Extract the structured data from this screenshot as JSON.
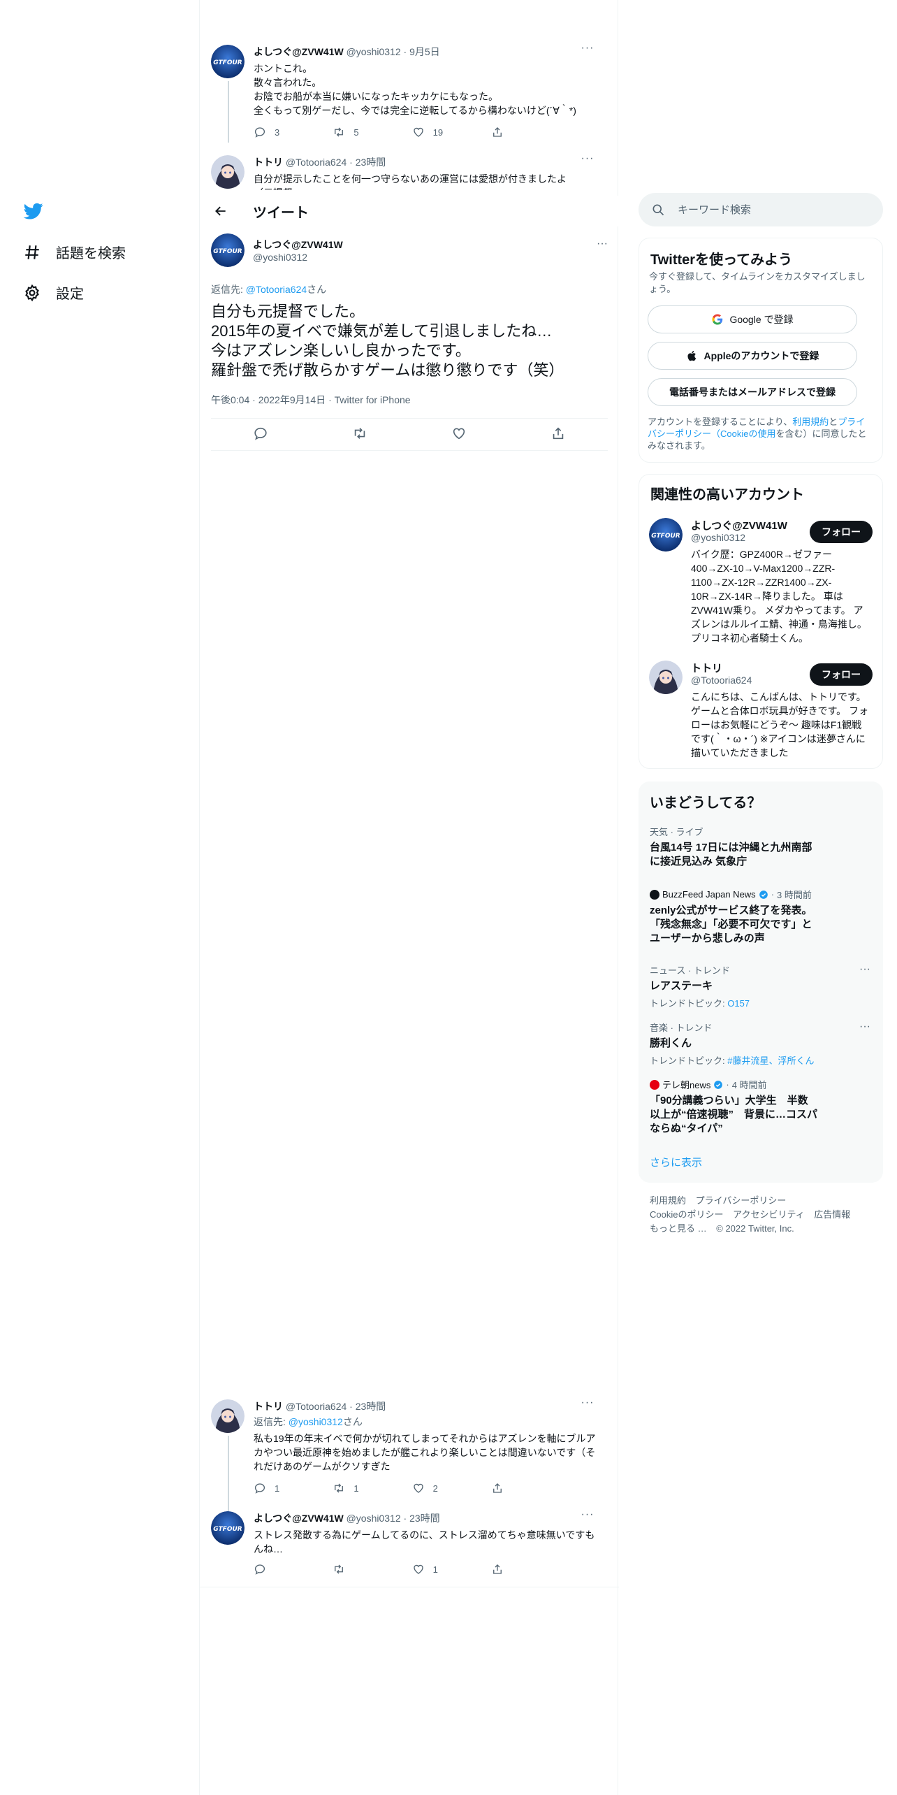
{
  "nav": {
    "explore_label": "話題を検索",
    "settings_label": "設定"
  },
  "header": {
    "title": "ツイート"
  },
  "tweets_above": [
    {
      "name": "よしつぐ@ZVW41W",
      "handle": "@yoshi0312",
      "time": "9月5日",
      "text": "ホントこれ。\n散々言われた。\nお陰でお船が本当に嫌いになったキッカケにもなった。\n全くもって別ゲーだし、今では完全に逆転してるから構わないけど(´∀｀*)",
      "replies": "3",
      "retweets": "5",
      "likes": "19"
    },
    {
      "name": "トトリ",
      "handle": "@Totooria624",
      "time": "23時間",
      "text": "自分が提示したことを何一つ守らないあの運営には愛想が付きましたよ\n（元提督"
    }
  ],
  "focused": {
    "name": "よしつぐ@ZVW41W",
    "handle": "@yoshi0312",
    "replying_prefix": "返信先: ",
    "replying_to": "@Totooria624",
    "replying_suffix": "さん",
    "text": "自分も元提督でした。\n2015年の夏イベで嫌気が差して引退しましたね…\n今はアズレン楽しいし良かったです。\n羅針盤で禿げ散らかすゲームは懲り懲りです（笑）",
    "meta": "午後0:04 · 2022年9月14日 · Twitter for iPhone"
  },
  "replies_below": [
    {
      "name": "トトリ",
      "handle": "@Totooria624",
      "time": "23時間",
      "replying_prefix": "返信先: ",
      "replying_to": "@yoshi0312",
      "replying_suffix": "さん",
      "text": "私も19年の年末イベで何かが切れてしまってそれからはアズレンを軸にブルアカやつい最近原神を始めましたが艦これより楽しいことは間違いないです（それだけあのゲームがクソすぎた",
      "replies": "1",
      "retweets": "1",
      "likes": "2"
    },
    {
      "name": "よしつぐ@ZVW41W",
      "handle": "@yoshi0312",
      "time": "23時間",
      "text": "ストレス発散する為にゲームしてるのに、ストレス溜めてちゃ意味無いですもんね…",
      "likes": "1"
    }
  ],
  "search": {
    "placeholder": "キーワード検索"
  },
  "signup": {
    "title": "Twitterを使ってみよう",
    "subtitle": "今すぐ登録して、タイムラインをカスタマイズしましょう。",
    "google_label": "Google で登録",
    "apple_label": "Appleのアカウントで登録",
    "phone_label": "電話番号またはメールアドレスで登録",
    "terms_1": "アカウントを登録することにより、",
    "terms_link1": "利用規約",
    "terms_2": "と",
    "terms_link2": "プライバシーポリシー（Cookieの使用",
    "terms_3": "を含む）に同意したとみなされます。"
  },
  "who_to_follow": {
    "title": "関連性の高いアカウント",
    "follow_label": "フォロー",
    "accounts": [
      {
        "name": "よしつぐ@ZVW41W",
        "handle": "@yoshi0312",
        "bio": "バイク歴：GPZ400R→ゼファー400→ZX-10→V-Max1200→ZZR-1100→ZX-12R→ZZR1400→ZX-10R→ZX-14R→降りました。 車はZVW41W乗り。 メダカやってます。 アズレンはルルイエ鯖、神通・鳥海推し。 プリコネ初心者騎士くん。"
      },
      {
        "name": "トトリ",
        "handle": "@Totooria624",
        "bio": "こんにちは、こんばんは、トトリです。ゲームと合体ロボ玩具が好きです。 フォローはお気軽にどうぞ～ 趣味はF1観戦です(｀・ω・´) ※アイコンは迷夢さんに描いていただきました"
      }
    ]
  },
  "trends": {
    "title": "いまどうしてる？",
    "show_more": "さらに表示",
    "items": [
      {
        "category": "天気 · ライブ",
        "title": "台風14号 17日には沖縄と九州南部に接近見込み 気象庁"
      },
      {
        "source": "BuzzFeed Japan News",
        "time": "3 時間前",
        "title": "zenly公式がサービス終了を発表。「残念無念」「必要不可欠です」とユーザーから悲しみの声"
      },
      {
        "category": "ニュース · トレンド",
        "title": "レアステーキ",
        "topic_prefix": "トレンドトピック: ",
        "topic": "O157"
      },
      {
        "category": "音楽 · トレンド",
        "title": "勝利くん",
        "topic_prefix": "トレンドトピック: ",
        "topic": "#藤井流星、浮所くん"
      },
      {
        "source": "テレ朝news",
        "time": "4 時間前",
        "title": "「90分講義つらい」大学生　半数以上が“倍速視聴”　背景に…コスパならぬ“タイパ”"
      }
    ]
  },
  "footer": {
    "links": [
      "利用規約",
      "プライバシーポリシー",
      "Cookieのポリシー",
      "アクセシビリティ",
      "広告情報",
      "もっと見る …"
    ],
    "copyright": "© 2022 Twitter, Inc."
  },
  "colors": {
    "accent": "#1d9bf0",
    "text": "#0f1419",
    "secondary": "#536471",
    "border": "#eff3f4"
  }
}
